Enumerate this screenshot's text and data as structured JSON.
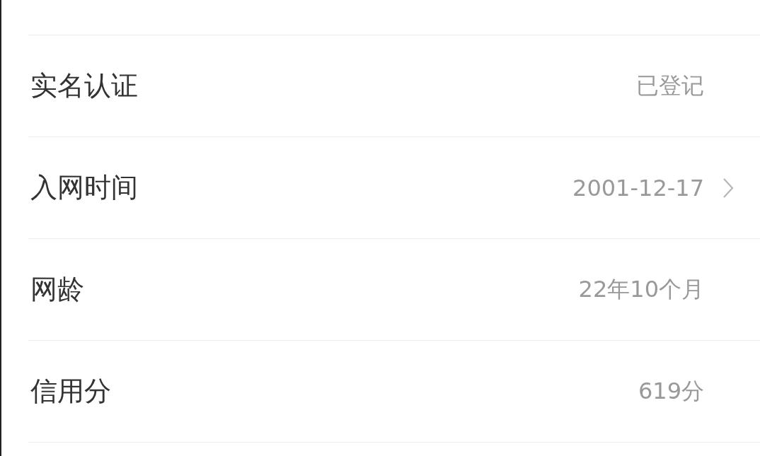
{
  "rows": [
    {
      "label": "实名认证",
      "value": "已登记",
      "kind": "info"
    },
    {
      "label": "入网时间",
      "value": "2001-12-17",
      "kind": "link"
    },
    {
      "label": "网龄",
      "value": "22年10个月",
      "kind": "info"
    },
    {
      "label": "信用分",
      "value": "619分",
      "kind": "info"
    }
  ]
}
